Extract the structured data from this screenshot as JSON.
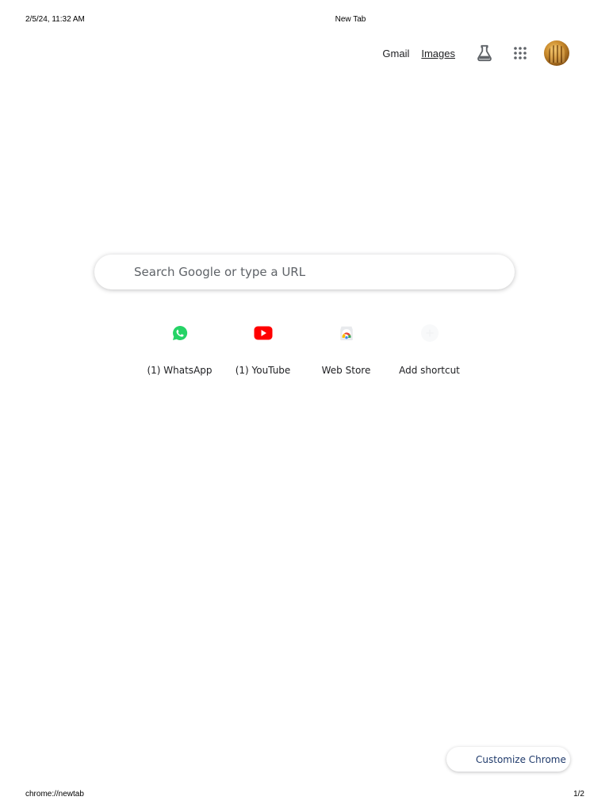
{
  "print_header": {
    "datetime": "2/5/24, 11:32 AM",
    "title": "New Tab"
  },
  "print_footer": {
    "url": "chrome://newtab",
    "page": "1/2"
  },
  "topbar": {
    "gmail_label": "Gmail",
    "images_label": "Images",
    "labs_icon": "flask-icon",
    "apps_icon": "apps-grid-icon",
    "avatar_icon": "account-avatar"
  },
  "search": {
    "placeholder": "Search Google or type a URL"
  },
  "shortcuts": [
    {
      "label": "(1) WhatsApp",
      "icon": "whatsapp-icon"
    },
    {
      "label": "(1) YouTube",
      "icon": "youtube-icon"
    },
    {
      "label": "Web Store",
      "icon": "chrome-web-store-icon"
    },
    {
      "label": "Add shortcut",
      "icon": "add-icon"
    }
  ],
  "customize": {
    "label": "Customize Chrome",
    "icon": "pencil-icon"
  },
  "colors": {
    "whatsapp": "#25d366",
    "youtube": "#ff0000",
    "text": "#202124",
    "muted": "#5f6368"
  }
}
